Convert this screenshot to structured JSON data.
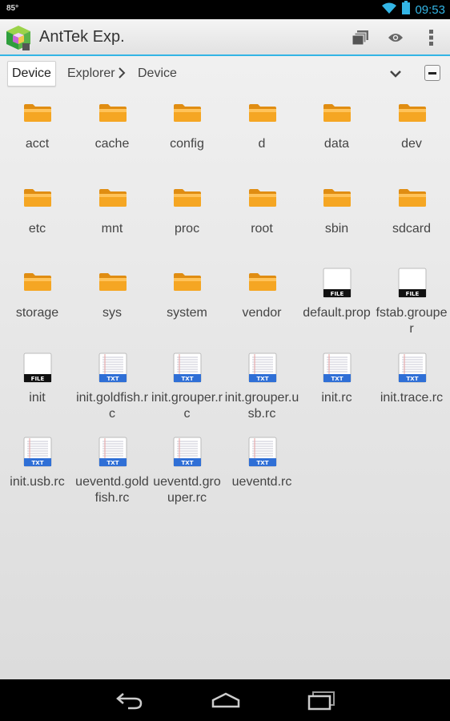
{
  "status_bar": {
    "temperature": "85°",
    "time": "09:53",
    "accent_color": "#33b5e5"
  },
  "action_bar": {
    "app_title": "AntTek Exp.",
    "icons": [
      "windows-icon",
      "eye-icon",
      "overflow-menu-icon"
    ]
  },
  "path_bar": {
    "root_button": "Device",
    "crumbs": [
      "Explorer",
      "Device"
    ]
  },
  "files": [
    {
      "name": "acct",
      "type": "folder"
    },
    {
      "name": "cache",
      "type": "folder"
    },
    {
      "name": "config",
      "type": "folder"
    },
    {
      "name": "d",
      "type": "folder"
    },
    {
      "name": "data",
      "type": "folder"
    },
    {
      "name": "dev",
      "type": "folder"
    },
    {
      "name": "etc",
      "type": "folder"
    },
    {
      "name": "mnt",
      "type": "folder"
    },
    {
      "name": "proc",
      "type": "folder"
    },
    {
      "name": "root",
      "type": "folder"
    },
    {
      "name": "sbin",
      "type": "folder"
    },
    {
      "name": "sdcard",
      "type": "folder"
    },
    {
      "name": "storage",
      "type": "folder"
    },
    {
      "name": "sys",
      "type": "folder"
    },
    {
      "name": "system",
      "type": "folder"
    },
    {
      "name": "vendor",
      "type": "folder"
    },
    {
      "name": "default.prop",
      "type": "file"
    },
    {
      "name": "fstab.grouper",
      "type": "file"
    },
    {
      "name": "init",
      "type": "file"
    },
    {
      "name": "init.goldfish.rc",
      "type": "txt"
    },
    {
      "name": "init.grouper.rc",
      "type": "txt"
    },
    {
      "name": "init.grouper.usb.rc",
      "type": "txt"
    },
    {
      "name": "init.rc",
      "type": "txt"
    },
    {
      "name": "init.trace.rc",
      "type": "txt"
    },
    {
      "name": "init.usb.rc",
      "type": "txt"
    },
    {
      "name": "ueventd.goldfish.rc",
      "type": "txt"
    },
    {
      "name": "ueventd.grouper.rc",
      "type": "txt"
    },
    {
      "name": "ueventd.rc",
      "type": "txt"
    }
  ],
  "icon_badges": {
    "file": "FILE",
    "txt": "TXT"
  },
  "colors": {
    "folder": "#f5a623",
    "txt_band": "#2f6fd6",
    "file_band": "#111111"
  }
}
